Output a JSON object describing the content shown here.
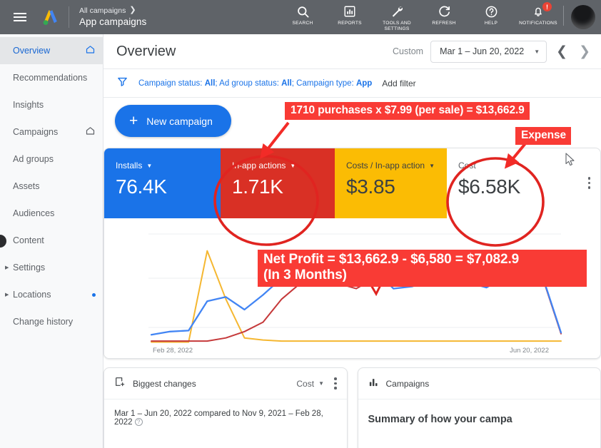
{
  "topbar": {
    "account_breadcrumb": "All campaigns",
    "account_name": "App campaigns",
    "actions": [
      {
        "label": "SEARCH",
        "icon": "search-icon"
      },
      {
        "label": "REPORTS",
        "icon": "reports-icon"
      },
      {
        "label": "TOOLS AND SETTINGS",
        "icon": "tools-and-settings-icon"
      },
      {
        "label": "REFRESH",
        "icon": "refresh-icon"
      },
      {
        "label": "HELP",
        "icon": "help-icon"
      },
      {
        "label": "NOTIFICATIONS",
        "icon": "notifications-bell-icon",
        "badge": "!"
      }
    ]
  },
  "sidebar": {
    "items": [
      {
        "label": "Overview",
        "active": true,
        "trailing": "home-icon"
      },
      {
        "label": "Recommendations",
        "active": false,
        "trailing": ""
      },
      {
        "label": "Insights",
        "active": false,
        "trailing": ""
      },
      {
        "label": "Campaigns",
        "active": false,
        "trailing": "home-icon"
      },
      {
        "label": "Ad groups",
        "active": false,
        "trailing": ""
      },
      {
        "label": "Assets",
        "active": false,
        "trailing": ""
      },
      {
        "label": "Audiences",
        "active": false,
        "trailing": ""
      },
      {
        "label": "Content",
        "active": false,
        "trailing": ""
      },
      {
        "label": "Settings",
        "active": false,
        "trailing": "",
        "expandable": true
      },
      {
        "label": "Locations",
        "active": false,
        "trailing": "dot",
        "expandable": true
      },
      {
        "label": "Change history",
        "active": false,
        "trailing": ""
      }
    ]
  },
  "header": {
    "title": "Overview",
    "custom_label": "Custom",
    "date_range": "Mar 1 – Jun 20, 2022"
  },
  "filters": {
    "summary_prefix": "Campaign status: ",
    "summary": "Campaign status: All; Ad group status: All; Campaign type: App",
    "parts": [
      {
        "text": "Campaign status: ",
        "bold": false
      },
      {
        "text": "All",
        "bold": true
      },
      {
        "text": "; Ad group status: ",
        "bold": false
      },
      {
        "text": "All",
        "bold": true
      },
      {
        "text": "; Campaign type: ",
        "bold": false
      },
      {
        "text": "App",
        "bold": true
      }
    ],
    "add_filter": "Add filter"
  },
  "actions": {
    "new_campaign": "New campaign"
  },
  "metrics": [
    {
      "label": "Installs",
      "value": "76.4K",
      "color": "#1a73e8",
      "has_dropdown": true
    },
    {
      "label": "In-app actions",
      "value": "1.71K",
      "color": "#d93025",
      "has_dropdown": true
    },
    {
      "label": "Costs / In-app action",
      "value": "$3.85",
      "color": "#fbbc04",
      "has_dropdown": true
    },
    {
      "label": "Cost",
      "value": "$6.58K",
      "color": "#ffffff",
      "has_dropdown": false
    }
  ],
  "chart_data": {
    "type": "line",
    "title": "",
    "xlabel": "",
    "ylabel": "",
    "x_tick_labels": [
      "Feb 28, 2022",
      "Jun 20, 2022"
    ],
    "x_start": "Feb 28, 2022",
    "x_end": "Jun 20, 2022",
    "grid": true,
    "legend": "none",
    "ylim": [
      0,
      100
    ],
    "series": [
      {
        "name": "Installs",
        "color": "#4285f4",
        "values": [
          8,
          11,
          12,
          40,
          44,
          32,
          46,
          62,
          72,
          76,
          74,
          70,
          70,
          52,
          54,
          60,
          63,
          58,
          53,
          64,
          65,
          64,
          10
        ]
      },
      {
        "name": "In-app actions",
        "color": "#c5393a",
        "values": [
          2,
          2,
          2,
          2,
          5,
          11,
          20,
          42,
          57,
          57,
          57,
          52,
          62,
          58,
          60,
          60,
          62,
          61,
          62,
          63,
          63,
          63,
          9
        ]
      },
      {
        "name": "Costs / In-app action",
        "color": "#f5b731",
        "values": [
          1,
          1,
          1,
          88,
          42,
          5,
          3,
          2,
          2,
          2,
          2,
          2,
          2,
          2,
          2,
          2,
          2,
          2,
          2,
          2,
          2,
          2,
          2
        ]
      }
    ]
  },
  "bottom_cards": {
    "biggest_changes": {
      "title": "Biggest changes",
      "icon": "changes-icon",
      "metric_select": "Cost",
      "comparison": "Mar 1 – Jun 20, 2022 compared to Nov 9, 2021 – Feb 28, 2022"
    },
    "campaigns": {
      "title": "Campaigns",
      "icon": "bar-chart-icon",
      "summary": "Summary of how your campa"
    }
  },
  "annotations": {
    "color": "#f93b35",
    "purchases": "1710 purchases x $7.99 (per sale) = $13,662.9",
    "expense": "Expense",
    "net_profit_line1": "Net Profit = $13,662.9 - $6,580 = $7,082.9",
    "net_profit_line2": "(In 3 Months)"
  }
}
